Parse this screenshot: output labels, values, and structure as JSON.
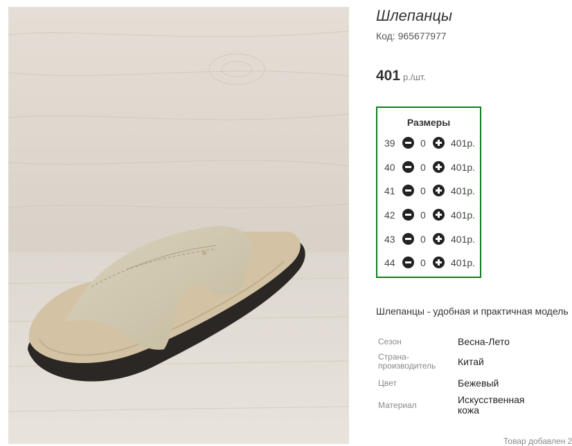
{
  "product": {
    "title": "Шлепанцы",
    "code": "Код: 965677977",
    "price": "401",
    "price_unit": "р./шт."
  },
  "sizes": {
    "title": "Размеры",
    "rows": [
      {
        "size": "39",
        "qty": "0",
        "price": "401р."
      },
      {
        "size": "40",
        "qty": "0",
        "price": "401р."
      },
      {
        "size": "41",
        "qty": "0",
        "price": "401р."
      },
      {
        "size": "42",
        "qty": "0",
        "price": "401р."
      },
      {
        "size": "43",
        "qty": "0",
        "price": "401р."
      },
      {
        "size": "44",
        "qty": "0",
        "price": "401р."
      }
    ]
  },
  "description": "Шлепанцы - удобная и практичная модель",
  "properties": [
    {
      "key": "Сезон",
      "value": "Весна-Лето"
    },
    {
      "key": "Страна-\nпроизводитель",
      "value": "Китай"
    },
    {
      "key": "Цвет",
      "value": "Бежевый"
    },
    {
      "key": "Материал",
      "value": "Искусственная\nкожа"
    }
  ],
  "footer": {
    "added": "Товар добавлен 2"
  },
  "colors": {
    "accent_border": "#0e7c1b",
    "button": "#222222"
  },
  "icons": {
    "minus": "minus-circle-icon",
    "plus": "plus-circle-icon"
  }
}
